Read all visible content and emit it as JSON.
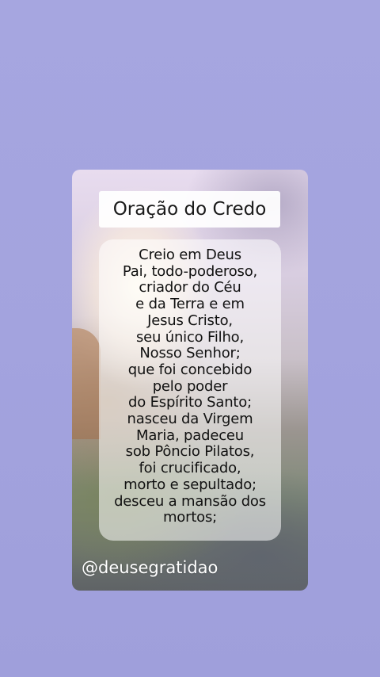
{
  "card": {
    "title": "Oração do Credo",
    "prayer_lines": [
      "Creio em Deus",
      "Pai, todo-poderoso,",
      "criador do Céu",
      "e da Terra e em",
      "Jesus Cristo,",
      "seu único Filho,",
      "Nosso Senhor;",
      "que foi concebido",
      "pelo poder",
      "do Espírito Santo;",
      "nasceu da Virgem",
      "Maria, padeceu",
      "sob Pôncio Pilatos,",
      "foi crucificado,",
      "morto e sepultado;",
      "desceu a mansão dos",
      "mortos;"
    ],
    "handle": "@deusegratidao"
  },
  "colors": {
    "background": "#a3a3de",
    "title_box": "#ffffff",
    "handle_text": "#ffffff"
  }
}
